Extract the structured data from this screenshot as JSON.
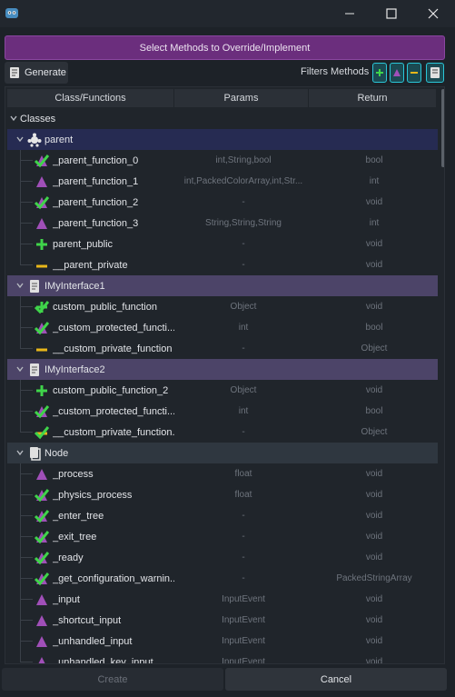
{
  "dialog": {
    "title": "Select Methods to Override/Implement"
  },
  "toolbar": {
    "generate_label": "Generate",
    "filters_label": "Filters Methods",
    "filter_icons": [
      "plus-icon",
      "triangle-icon",
      "minus-icon",
      "script-icon"
    ]
  },
  "columns": {
    "name": "Class/Functions",
    "params": "Params",
    "return": "Return"
  },
  "tree": {
    "root_label": "Classes",
    "groups": [
      {
        "label": "parent",
        "icon": "class-node-icon",
        "style": "dark",
        "items": [
          {
            "name": "_parent_function_0",
            "params": "int,String,bool",
            "ret": "bool",
            "icon": "check-triangle-icon"
          },
          {
            "name": "_parent_function_1",
            "params": "int,PackedColorArray,int,Str...",
            "ret": "int",
            "icon": "triangle-icon"
          },
          {
            "name": "_parent_function_2",
            "params": "-",
            "ret": "void",
            "icon": "check-triangle-icon"
          },
          {
            "name": "_parent_function_3",
            "params": "String,String,String",
            "ret": "int",
            "icon": "triangle-icon"
          },
          {
            "name": "parent_public",
            "params": "-",
            "ret": "void",
            "icon": "plus-icon"
          },
          {
            "name": "__parent_private",
            "params": "-",
            "ret": "void",
            "icon": "minus-icon"
          }
        ]
      },
      {
        "label": "IMyInterface1",
        "icon": "script-icon",
        "style": "iface",
        "items": [
          {
            "name": "custom_public_function",
            "params": "Object",
            "ret": "void",
            "icon": "check-plus-icon"
          },
          {
            "name": "_custom_protected_functi...",
            "params": "int",
            "ret": "bool",
            "icon": "check-triangle-icon"
          },
          {
            "name": "__custom_private_function",
            "params": "-",
            "ret": "Object",
            "icon": "minus-icon"
          }
        ]
      },
      {
        "label": "IMyInterface2",
        "icon": "script-icon",
        "style": "iface",
        "items": [
          {
            "name": "custom_public_function_2",
            "params": "Object",
            "ret": "void",
            "icon": "plus-icon"
          },
          {
            "name": "_custom_protected_functi...",
            "params": "int",
            "ret": "bool",
            "icon": "check-triangle-icon"
          },
          {
            "name": "__custom_private_function...",
            "params": "-",
            "ret": "Object",
            "icon": "check-minus-icon"
          }
        ]
      },
      {
        "label": "Node",
        "icon": "node-icon",
        "style": "plain",
        "items": [
          {
            "name": "_process",
            "params": "float",
            "ret": "void",
            "icon": "triangle-icon"
          },
          {
            "name": "_physics_process",
            "params": "float",
            "ret": "void",
            "icon": "check-triangle-icon"
          },
          {
            "name": "_enter_tree",
            "params": "-",
            "ret": "void",
            "icon": "check-triangle-icon"
          },
          {
            "name": "_exit_tree",
            "params": "-",
            "ret": "void",
            "icon": "check-triangle-icon"
          },
          {
            "name": "_ready",
            "params": "-",
            "ret": "void",
            "icon": "check-triangle-icon"
          },
          {
            "name": "_get_configuration_warnin...",
            "params": "-",
            "ret": "PackedStringArray",
            "icon": "check-triangle-icon"
          },
          {
            "name": "_input",
            "params": "InputEvent",
            "ret": "void",
            "icon": "triangle-icon"
          },
          {
            "name": "_shortcut_input",
            "params": "InputEvent",
            "ret": "void",
            "icon": "triangle-icon"
          },
          {
            "name": "_unhandled_input",
            "params": "InputEvent",
            "ret": "void",
            "icon": "triangle-icon"
          },
          {
            "name": "_unhandled_key_input",
            "params": "InputEvent",
            "ret": "void",
            "icon": "triangle-icon"
          }
        ]
      }
    ]
  },
  "footer": {
    "create_label": "Create",
    "cancel_label": "Cancel"
  },
  "colors": {
    "accent_purple": "#6b2e7d",
    "accent_cyan": "#2ac6d8",
    "check_green": "#3fd44a",
    "triangle_purple": "#a04fb8",
    "minus_yellow": "#e8b61a"
  }
}
